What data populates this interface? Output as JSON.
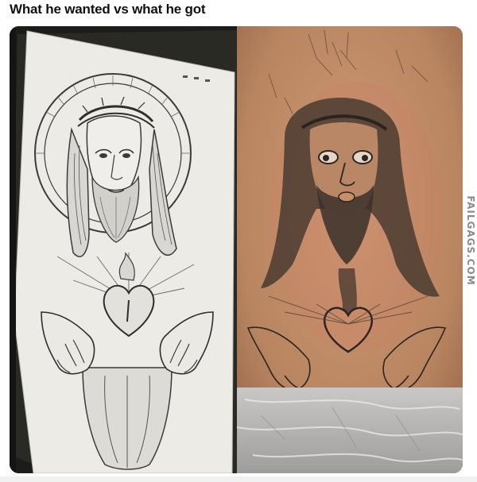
{
  "post": {
    "title": "What he wanted vs what he got"
  },
  "image": {
    "left_panel": "tattoo-design-sketch",
    "right_panel": "tattoo-result-photo",
    "watermark": "FAILGAGS.COM"
  },
  "colors": {
    "paper": "#eceae6",
    "ink": "#3a3a3a",
    "skin": "#c79472",
    "tattoo_ink": "#2c2622"
  }
}
